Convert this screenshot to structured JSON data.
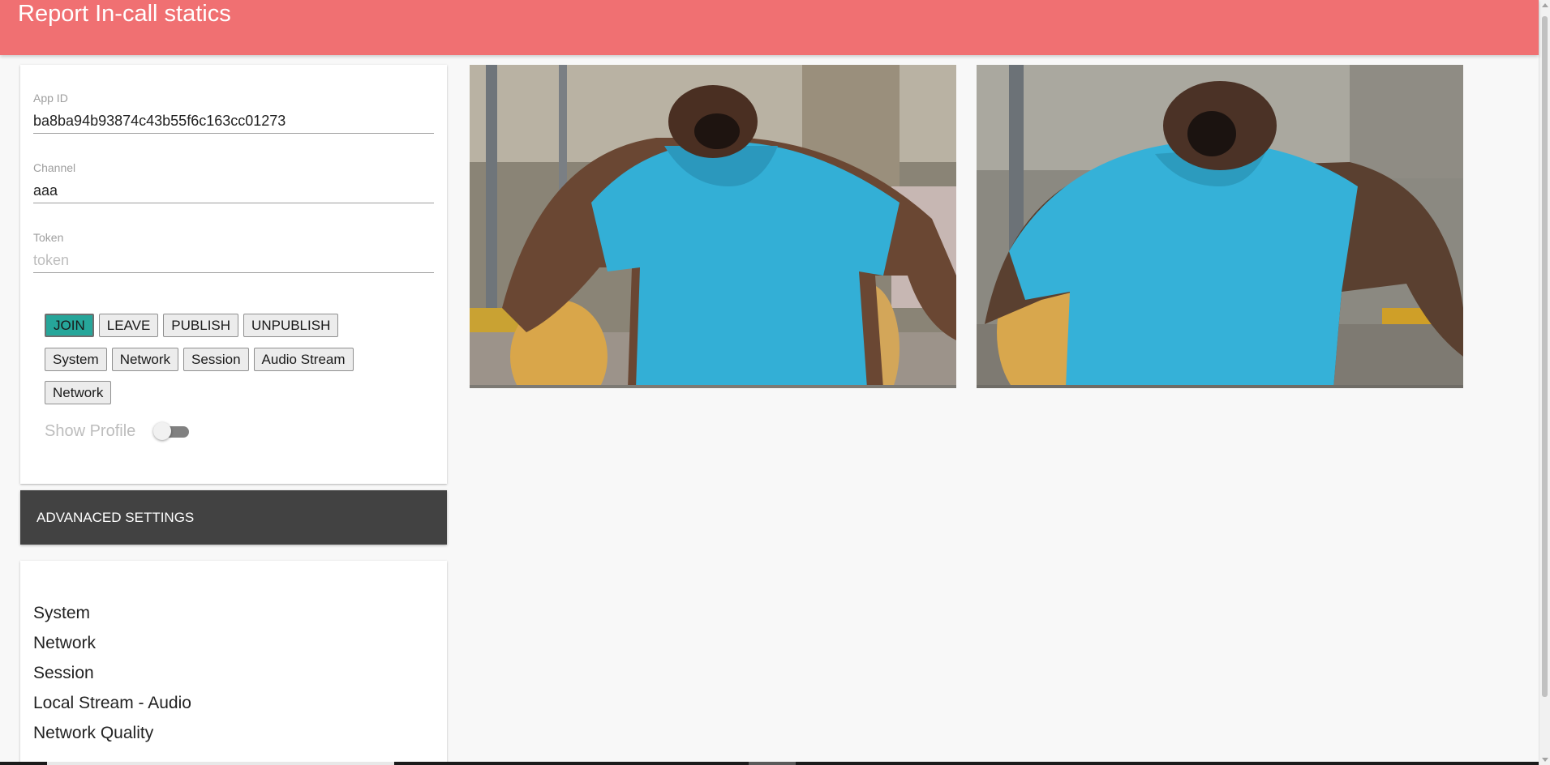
{
  "header": {
    "title": "Report In-call statics",
    "background": "#f07072"
  },
  "config": {
    "app_id": {
      "label": "App ID",
      "value": "ba8ba94b93874c43b55f6c163cc01273"
    },
    "channel": {
      "label": "Channel",
      "value": "aaa"
    },
    "token": {
      "label": "Token",
      "value": "",
      "placeholder": "token"
    },
    "action_buttons": [
      "JOIN",
      "LEAVE",
      "PUBLISH",
      "UNPUBLISH"
    ],
    "active_button": "JOIN",
    "stat_buttons": [
      "System",
      "Network",
      "Session",
      "Audio Stream",
      "Network"
    ],
    "show_profile": {
      "label": "Show Profile",
      "on": false
    }
  },
  "advanced": {
    "label": "ADVANACED SETTINGS",
    "background": "#424242"
  },
  "stats": {
    "items": [
      "System",
      "Network",
      "Session",
      "Local Stream - Audio",
      "Network Quality"
    ]
  },
  "colors": {
    "accent": "#26a69a"
  },
  "videos": [
    "local-video",
    "remote-video"
  ]
}
